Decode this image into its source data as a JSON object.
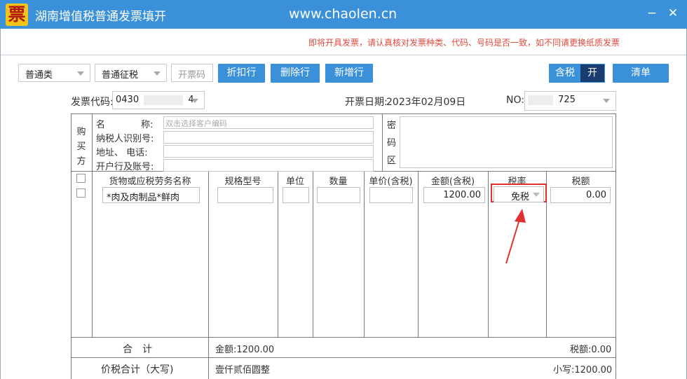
{
  "window": {
    "logo_char": "票",
    "title": "湖南增值税普通发票填开",
    "site": "www.chaolen.cn",
    "minimize": "−",
    "close": "✕"
  },
  "notice": "即将开具发票，请认真核对发票种类、代码、号码是否一致，如不同请更换纸质发票",
  "toolbar": {
    "invoice_class": "普通类",
    "levy_type": "普通征税",
    "invoice_no_placeholder": "开票码",
    "discount_btn": "折扣行",
    "delete_btn": "删除行",
    "add_btn": "新增行",
    "tax_incl_label": "含税",
    "tax_incl_state": "开",
    "clear_btn": "清单"
  },
  "header": {
    "code_label": "发票代码:",
    "code_prefix": "0430",
    "code_suffix": "4",
    "date_label": "开票日期:",
    "date_value": "2023年02月09日",
    "no_label": "NO:",
    "no_suffix": "725"
  },
  "buyer": {
    "section_chars": [
      "购",
      "买",
      "方"
    ],
    "name_label_a": "名",
    "name_label_b": "称:",
    "name_placeholder": "双击选择客户编码",
    "taxid_label": "纳税人识别号:",
    "addr_label": "地址、 电话:",
    "bank_label": "开户行及账号:",
    "secret_chars": [
      "密",
      "码",
      "区"
    ]
  },
  "items": {
    "headers": [
      "货物或应税劳务名称",
      "规格型号",
      "单位",
      "数量",
      "单价(含税)",
      "金额(含税)",
      "税率",
      "税额"
    ],
    "row": {
      "name": "*肉及肉制品*鲜肉",
      "spec": "",
      "unit": "",
      "qty": "",
      "price": "",
      "amount": "1200.00",
      "rate": "免税",
      "tax": "0.00"
    }
  },
  "totals": {
    "sum_label": "合　计",
    "amount_text": "金额:1200.00",
    "tax_text": "税额:0.00",
    "grand_label": "价税合计（大写)",
    "grand_upper": "壹仟贰佰圆整",
    "grand_lower": "小写:1200.00"
  },
  "colors": {
    "accent": "#3a90d9",
    "highlight": "#e03030",
    "notice": "#e04a3e"
  }
}
